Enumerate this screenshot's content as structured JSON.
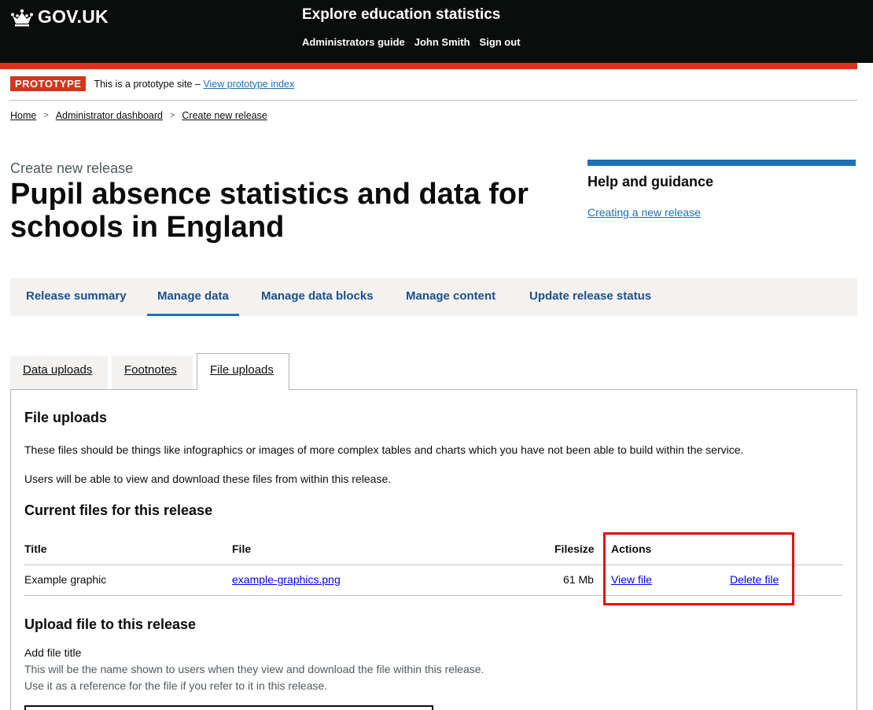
{
  "header": {
    "logo_text": "GOV.UK",
    "service_name": "Explore education statistics",
    "nav": [
      "Administrators guide",
      "John Smith",
      "Sign out"
    ]
  },
  "phase": {
    "tag": "PROTOTYPE",
    "text": "This is a prototype site – ",
    "link": "View prototype index"
  },
  "breadcrumb": [
    "Home",
    "Administrator dashboard",
    "Create new release"
  ],
  "caption": "Create new release",
  "title": "Pupil absence statistics and data for schools in England",
  "help": {
    "title": "Help and guidance",
    "link": "Creating a new release"
  },
  "primary_nav": [
    "Release summary",
    "Manage data",
    "Manage data blocks",
    "Manage content",
    "Update release status"
  ],
  "primary_nav_active": "Manage data",
  "tabs": [
    "Data uploads",
    "Footnotes",
    "File uploads"
  ],
  "tabs_active": "File uploads",
  "section": {
    "heading": "File uploads",
    "para1": "These files should be things like infographics or images of more complex tables and charts which you have not been able to build within the service.",
    "para2": "Users will be able to view and download these files from within this release.",
    "current_heading": "Current files for this release"
  },
  "table": {
    "headers": [
      "Title",
      "File",
      "Filesize",
      "Actions"
    ],
    "rows": [
      {
        "title": "Example graphic",
        "file": "example-graphics.png",
        "filesize": "61 Mb",
        "view": "View file",
        "delete": "Delete file"
      }
    ]
  },
  "upload": {
    "heading": "Upload file to this release",
    "label": "Add file title",
    "hint1": "This will be the name shown to users when they view and download the file within this release.",
    "hint2": "Use it as a reference for the file if you refer to it in this release.",
    "value": ""
  },
  "colors": {
    "header_bg": "#0b0c0c",
    "accent_red": "#d4351c",
    "link_blue": "#1d70b8",
    "highlight": "#e30613"
  }
}
